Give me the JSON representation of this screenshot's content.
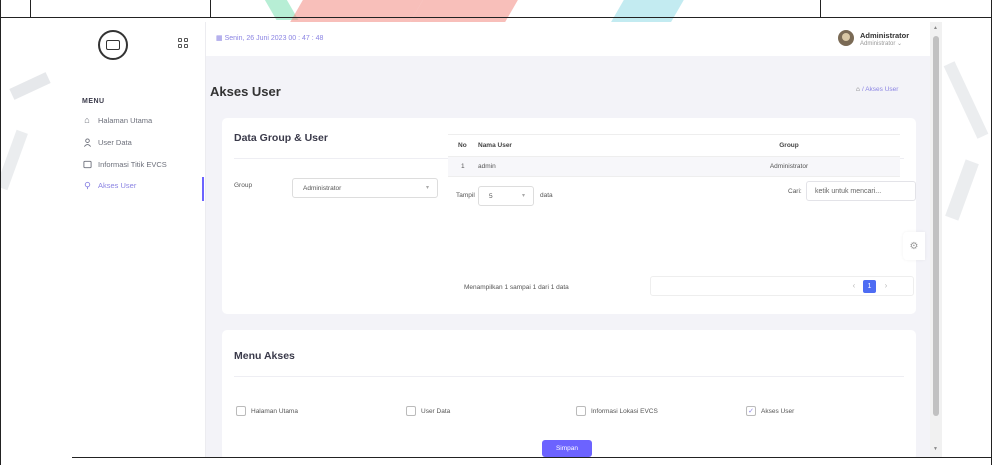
{
  "topbar": {
    "date": "Senin, 26 Juni 2023  00 : 47 : 48",
    "user_name": "Administrator",
    "user_role": "Administrator ⌄"
  },
  "sidebar": {
    "menu_title": "MENU",
    "items": [
      {
        "label": "Halaman Utama",
        "icon": "home-icon"
      },
      {
        "label": "User Data",
        "icon": "user-icon"
      },
      {
        "label": "Informasi Titik EVCS",
        "icon": "tablet-icon"
      },
      {
        "label": "Akses User",
        "icon": "key-icon"
      }
    ]
  },
  "page": {
    "title": "Akses User",
    "breadcrumb_current": "/ Akses User"
  },
  "group_card": {
    "title": "Data Group & User",
    "group_label": "Group",
    "group_selected": "Administrator",
    "show_label": "Tampil",
    "show_value": "5",
    "show_suffix": "data",
    "search_label": "Cari:",
    "search_placeholder": "ketik untuk mencari..."
  },
  "table": {
    "headers": [
      "No",
      "Nama User",
      "Group"
    ],
    "rows": [
      {
        "no": "1",
        "name": "admin",
        "group": "Administrator"
      }
    ],
    "info": "Menampilkan 1 sampai 1 dari 1 data",
    "page": "1",
    "prev": "‹",
    "next": "›"
  },
  "menu_card": {
    "title": "Menu Akses",
    "options": [
      {
        "label": "Halaman Utama",
        "checked": false
      },
      {
        "label": "User Data",
        "checked": false
      },
      {
        "label": "Informasi Lokasi EVCS",
        "checked": false
      },
      {
        "label": "Akses User",
        "checked": true
      }
    ]
  },
  "save_label": "Simpan",
  "colors": {
    "accent": "#6c63ff",
    "pagination": "#4e6cf3",
    "background": "#f3f3f8"
  }
}
